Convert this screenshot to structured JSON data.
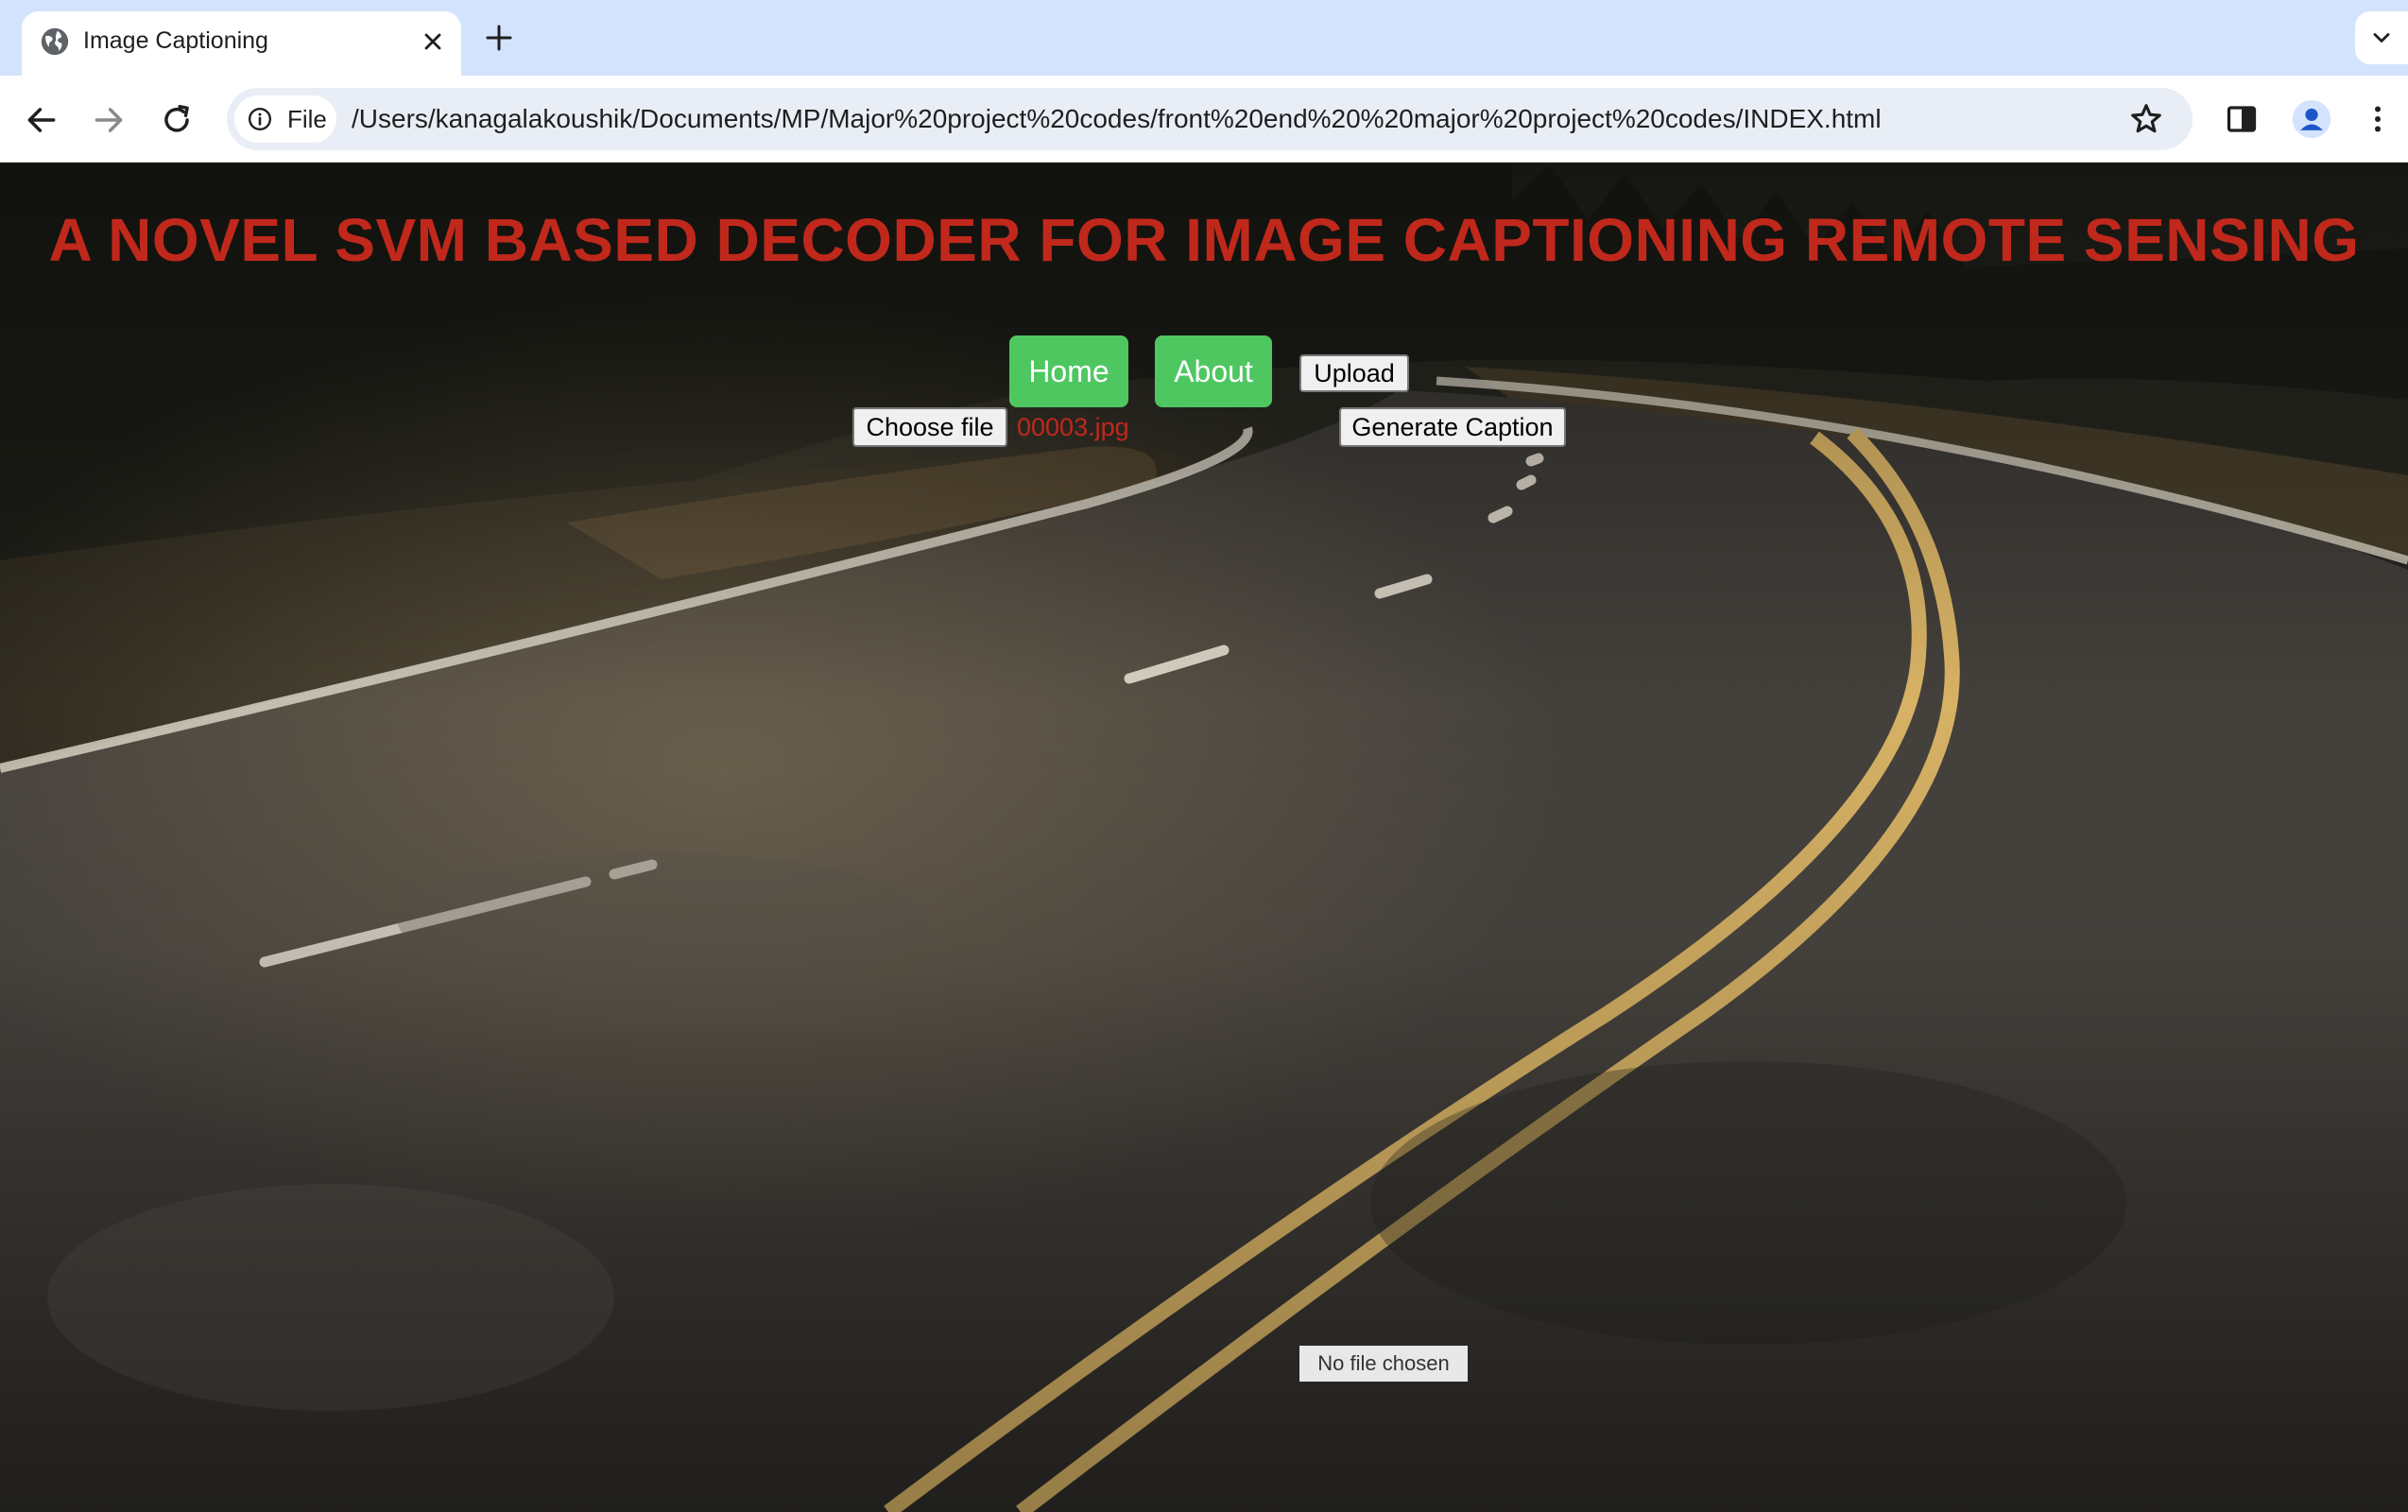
{
  "browser": {
    "tab_title": "Image Captioning",
    "file_chip_label": "File",
    "url": "/Users/kanagalakoushik/Documents/MP/Major%20project%20codes/front%20end%20%20major%20project%20codes/INDEX.html"
  },
  "page": {
    "title": "A NOVEL SVM BASED DECODER FOR IMAGE CAPTIONING REMOTE SENSING",
    "nav": {
      "home_label": "Home",
      "about_label": "About"
    },
    "upload_label": "Upload",
    "choose_file_label": "Choose file",
    "selected_file": "00003.jpg",
    "generate_label": "Generate Caption",
    "status_text": "No file chosen"
  },
  "colors": {
    "title_red": "#c0281c",
    "nav_green": "#4fc761",
    "tabstrip_blue": "#d3e3fd"
  }
}
